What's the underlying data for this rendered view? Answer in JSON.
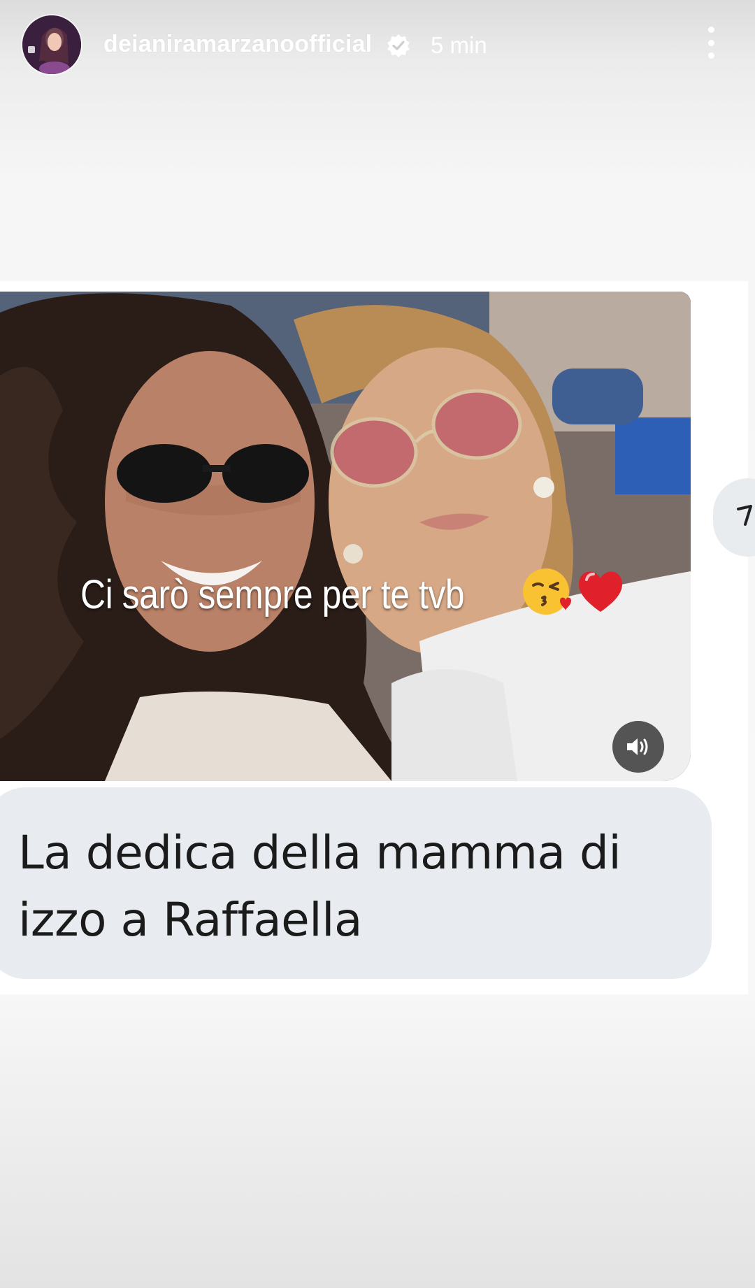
{
  "header": {
    "username": "deianiramarzanoofficial",
    "verified_icon": "verified-badge-icon",
    "timestamp": "5 min",
    "menu_icon": "more-vertical-icon",
    "avatar_icon": "profile-avatar"
  },
  "post": {
    "overlay_text": "Ci sarò sempre per te tvb",
    "emojis": [
      "😘",
      "❤️"
    ],
    "sound_icon": "speaker-sound-icon",
    "caption": "La dedica della mamma di izzo a Raffaella",
    "side_icon": "share-arrow-icon"
  },
  "colors": {
    "caption_bubble": "#e8ecf0",
    "caption_text": "#1b1b1b",
    "header_text": "#ffffff"
  }
}
